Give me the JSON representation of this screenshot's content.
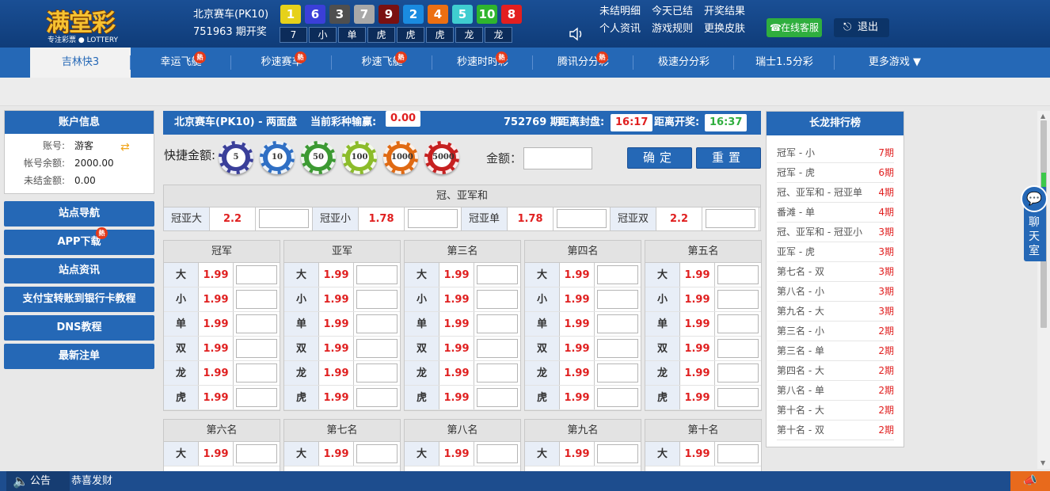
{
  "logo": {
    "main": "满堂彩",
    "sub": "专注彩票 ● LOTTERY"
  },
  "lottery": {
    "name": "北京赛车(PK10)",
    "issue_text": "751963 期开奖"
  },
  "balls": [
    {
      "n": "1",
      "color": "#e6d11a"
    },
    {
      "n": "6",
      "color": "#3b3fd8"
    },
    {
      "n": "3",
      "color": "#4f4f4f"
    },
    {
      "n": "7",
      "color": "#a8a8a8"
    },
    {
      "n": "9",
      "color": "#7a1111"
    },
    {
      "n": "2",
      "color": "#1a8be0"
    },
    {
      "n": "4",
      "color": "#ec6f12"
    },
    {
      "n": "5",
      "color": "#3fcdd0"
    },
    {
      "n": "10",
      "color": "#2fb52e"
    },
    {
      "n": "8",
      "color": "#e31f1f"
    }
  ],
  "attrs": [
    "7",
    "小",
    "单",
    "虎",
    "虎",
    "虎",
    "龙",
    "龙"
  ],
  "top_links": [
    "未结明细",
    "今天已结",
    "开奖结果",
    "个人资讯",
    "游戏规则",
    "更换皮肤"
  ],
  "service_label": "在线客服",
  "logout_label": "退出",
  "nav": {
    "items": [
      "吉林快3",
      "幸运飞艇",
      "秒速赛车",
      "秒速飞艇",
      "秒速时时彩",
      "腾讯分分彩",
      "极速分分彩",
      "瑞士1.5分彩",
      "更多游戏 ▼"
    ],
    "hot_label": "熱"
  },
  "account": {
    "title": "账户信息",
    "rows": [
      {
        "label": "账号:",
        "value": "游客"
      },
      {
        "label": "帐号余额:",
        "value": "2000.00"
      },
      {
        "label": "未结金额:",
        "value": "0.00"
      }
    ]
  },
  "side_buttons": [
    "站点导航",
    "APP下载",
    "站点资讯",
    "支付宝转账到银行卡教程",
    "DNS教程",
    "最新注单"
  ],
  "main_header": {
    "title": "北京赛车(PK10)  -  两面盘",
    "pnl_label": "当前彩种输赢:",
    "pnl": "0.00",
    "issue": "752769 期",
    "close_label": "距离封盘:",
    "close_time": "16:17",
    "draw_label": "距离开奖:",
    "draw_time": "16:37"
  },
  "quick": {
    "label": "快捷金额:",
    "chips": [
      {
        "v": "5",
        "color": "#3a3f9a"
      },
      {
        "v": "10",
        "color": "#2f6fc4"
      },
      {
        "v": "50",
        "color": "#3c9a32"
      },
      {
        "v": "100",
        "color": "#8cbc2a"
      },
      {
        "v": "1000",
        "color": "#e06a13"
      },
      {
        "v": "5000",
        "color": "#c62020"
      }
    ]
  },
  "amount_label": "金额：",
  "confirm_label": "确定",
  "reset_label": "重置",
  "top_table": {
    "title": "冠、亚军和",
    "items": [
      {
        "label": "冠亚大",
        "odds": "2.2"
      },
      {
        "label": "冠亚小",
        "odds": "1.78"
      },
      {
        "label": "冠亚单",
        "odds": "1.78"
      },
      {
        "label": "冠亚双",
        "odds": "2.2"
      }
    ]
  },
  "groups": [
    {
      "title": "冠军",
      "rows": [
        {
          "l": "大",
          "o": "1.99"
        },
        {
          "l": "小",
          "o": "1.99"
        },
        {
          "l": "单",
          "o": "1.99"
        },
        {
          "l": "双",
          "o": "1.99"
        },
        {
          "l": "龙",
          "o": "1.99"
        },
        {
          "l": "虎",
          "o": "1.99"
        }
      ]
    },
    {
      "title": "亚军",
      "rows": [
        {
          "l": "大",
          "o": "1.99"
        },
        {
          "l": "小",
          "o": "1.99"
        },
        {
          "l": "单",
          "o": "1.99"
        },
        {
          "l": "双",
          "o": "1.99"
        },
        {
          "l": "龙",
          "o": "1.99"
        },
        {
          "l": "虎",
          "o": "1.99"
        }
      ]
    },
    {
      "title": "第三名",
      "rows": [
        {
          "l": "大",
          "o": "1.99"
        },
        {
          "l": "小",
          "o": "1.99"
        },
        {
          "l": "单",
          "o": "1.99"
        },
        {
          "l": "双",
          "o": "1.99"
        },
        {
          "l": "龙",
          "o": "1.99"
        },
        {
          "l": "虎",
          "o": "1.99"
        }
      ]
    },
    {
      "title": "第四名",
      "rows": [
        {
          "l": "大",
          "o": "1.99"
        },
        {
          "l": "小",
          "o": "1.99"
        },
        {
          "l": "单",
          "o": "1.99"
        },
        {
          "l": "双",
          "o": "1.99"
        },
        {
          "l": "龙",
          "o": "1.99"
        },
        {
          "l": "虎",
          "o": "1.99"
        }
      ]
    },
    {
      "title": "第五名",
      "rows": [
        {
          "l": "大",
          "o": "1.99"
        },
        {
          "l": "小",
          "o": "1.99"
        },
        {
          "l": "单",
          "o": "1.99"
        },
        {
          "l": "双",
          "o": "1.99"
        },
        {
          "l": "龙",
          "o": "1.99"
        },
        {
          "l": "虎",
          "o": "1.99"
        }
      ]
    },
    {
      "title": "第六名",
      "rows": [
        {
          "l": "大",
          "o": "1.99"
        }
      ]
    },
    {
      "title": "第七名",
      "rows": [
        {
          "l": "大",
          "o": "1.99"
        }
      ]
    },
    {
      "title": "第八名",
      "rows": [
        {
          "l": "大",
          "o": "1.99"
        }
      ]
    },
    {
      "title": "第九名",
      "rows": [
        {
          "l": "大",
          "o": "1.99"
        }
      ]
    },
    {
      "title": "第十名",
      "rows": [
        {
          "l": "大",
          "o": "1.99"
        }
      ]
    }
  ],
  "rank": {
    "title": "长龙排行榜",
    "items": [
      {
        "n": "冠军 - 小",
        "p": "7期"
      },
      {
        "n": "冠军 - 虎",
        "p": "6期"
      },
      {
        "n": "冠、亚军和 - 冠亚单",
        "p": "4期"
      },
      {
        "n": "番滩 - 单",
        "p": "4期"
      },
      {
        "n": "冠、亚军和 - 冠亚小",
        "p": "3期"
      },
      {
        "n": "亚军 - 虎",
        "p": "3期"
      },
      {
        "n": "第七名 - 双",
        "p": "3期"
      },
      {
        "n": "第八名 - 小",
        "p": "3期"
      },
      {
        "n": "第九名 - 大",
        "p": "3期"
      },
      {
        "n": "第三名 - 小",
        "p": "2期"
      },
      {
        "n": "第三名 - 单",
        "p": "2期"
      },
      {
        "n": "第四名 - 大",
        "p": "2期"
      },
      {
        "n": "第八名 - 单",
        "p": "2期"
      },
      {
        "n": "第十名 - 大",
        "p": "2期"
      },
      {
        "n": "第十名 - 双",
        "p": "2期"
      }
    ]
  },
  "chat_label": "聊天室",
  "footer": {
    "label": "公告",
    "message": "恭喜发财"
  }
}
